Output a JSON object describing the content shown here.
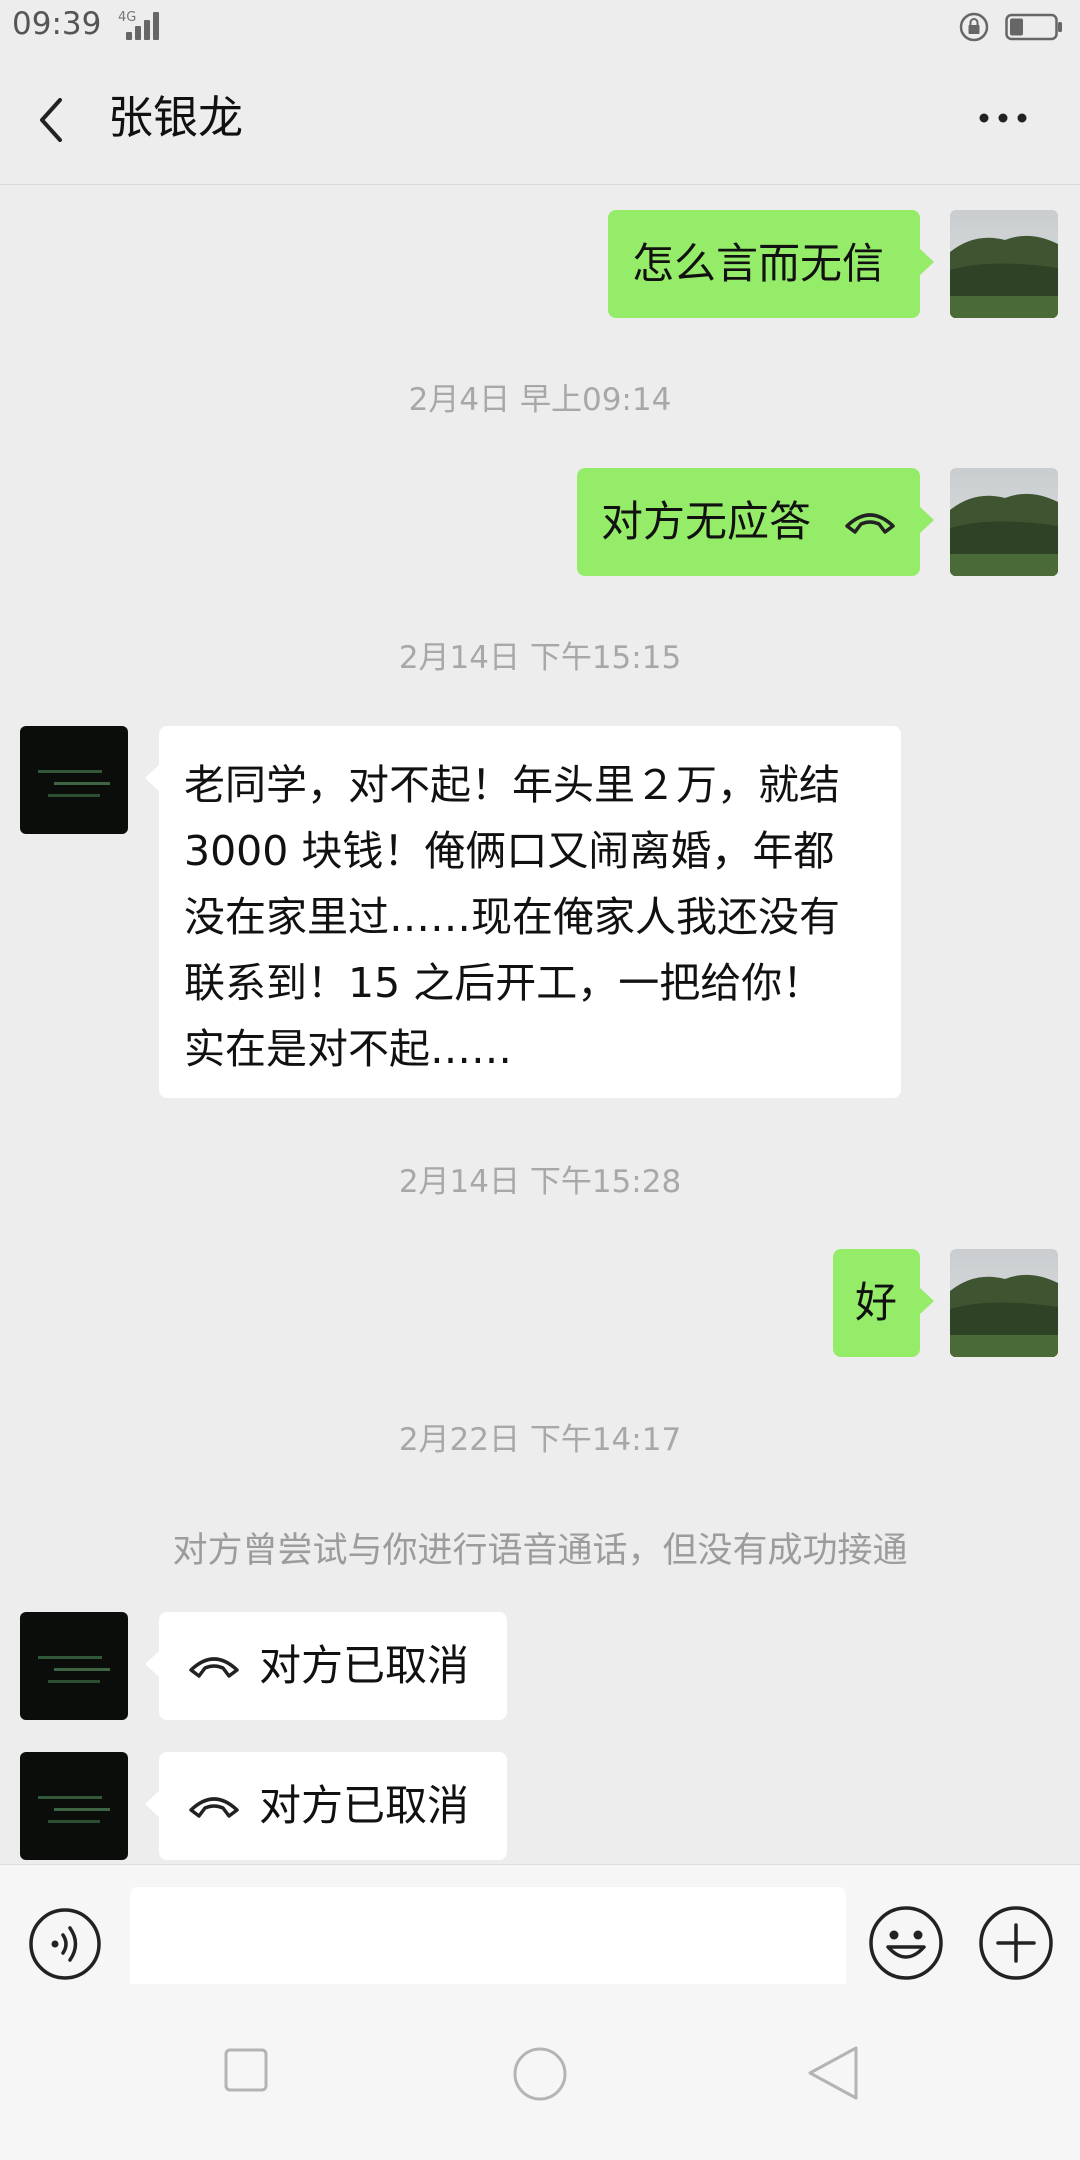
{
  "status_bar": {
    "time": "09:39",
    "network": "4G",
    "battery_level": 0.3
  },
  "header": {
    "title": "张银龙",
    "back_icon": "chevron-left-icon",
    "more_icon": "more-dots-icon"
  },
  "messages": [
    {
      "direction": "out",
      "text": "怎么言而无信"
    },
    {
      "time": "2月4日 早上09:14"
    },
    {
      "direction": "out",
      "text": "对方无应答",
      "icon": "phone-hangup-icon"
    },
    {
      "time": "2月14日 下午15:15"
    },
    {
      "direction": "in",
      "lines": [
        "老同学，对不起！年头里２万，就结",
        "3000 块钱！俺俩口又闹离婚，年都",
        "没在家里过……现在俺家人我还没有",
        "联系到！15 之后开工，一把给你！",
        "实在是对不起……"
      ]
    },
    {
      "time": "2月14日 下午15:28"
    },
    {
      "direction": "out",
      "text": "好"
    },
    {
      "time": "2月22日 下午14:17"
    },
    {
      "system": "对方曾尝试与你进行语音通话，但没有成功接通"
    },
    {
      "direction": "in",
      "text": "对方已取消",
      "icon": "phone-hangup-icon"
    },
    {
      "direction": "in",
      "text": "对方已取消",
      "icon": "phone-hangup-icon"
    }
  ],
  "input_bar": {
    "voice_icon": "voice-icon",
    "message_value": "",
    "emoji_icon": "emoji-icon",
    "plus_icon": "plus-icon"
  },
  "nav_bar": {
    "recent_icon": "square-icon",
    "home_icon": "circle-icon",
    "back_icon": "triangle-back-icon"
  },
  "colors": {
    "background": "#ededed",
    "outgoing_bubble": "#95ec69",
    "incoming_bubble": "#ffffff",
    "timestamp_text": "#a8a8a8"
  }
}
